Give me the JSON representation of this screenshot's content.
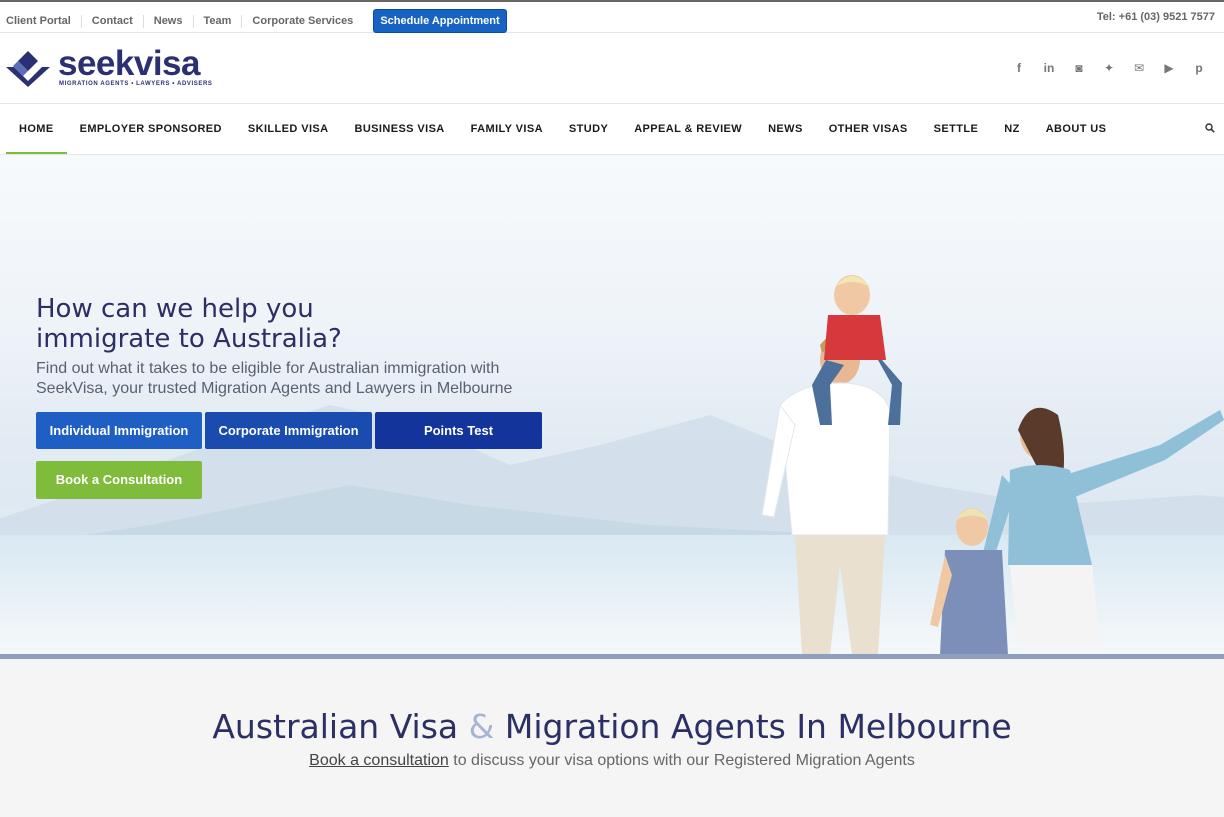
{
  "topbar": {
    "links": [
      "Client Portal",
      "Contact",
      "News",
      "Team",
      "Corporate Services"
    ],
    "schedule_label": "Schedule Appointment",
    "phone": "Tel: +61 (03) 9521 7577"
  },
  "brand": {
    "name": "seekvisa",
    "tagline": "MIGRATION AGENTS • LAWYERS • ADVISERS",
    "color": "#2b2f73"
  },
  "social": [
    {
      "icon": "facebook-icon",
      "glyph": "f"
    },
    {
      "icon": "linkedin-icon",
      "glyph": "in"
    },
    {
      "icon": "instagram-icon",
      "glyph": "◙"
    },
    {
      "icon": "twitter-icon",
      "glyph": "✦"
    },
    {
      "icon": "mail-icon",
      "glyph": "✉"
    },
    {
      "icon": "youtube-icon",
      "glyph": "▶"
    },
    {
      "icon": "pinterest-icon",
      "glyph": "p"
    }
  ],
  "nav": {
    "items": [
      "HOME",
      "EMPLOYER SPONSORED",
      "SKILLED VISA",
      "BUSINESS VISA",
      "FAMILY VISA",
      "STUDY",
      "APPEAL & REVIEW",
      "NEWS",
      "OTHER VISAS",
      "SETTLE",
      "NZ",
      "ABOUT US"
    ],
    "active": "HOME",
    "search_icon": "search-icon"
  },
  "hero": {
    "heading_line1": "How can we help you",
    "heading_line2": "immigrate to Australia?",
    "subtext_line1": "Find out what it takes to be eligible for Australian immigration with",
    "subtext_line2": "SeekVisa, your trusted Migration Agents and Lawyers in Melbourne",
    "buttons": {
      "individual": "Individual Immigration",
      "corporate": "Corporate Immigration",
      "points": "Points Test",
      "book": "Book a Consultation"
    }
  },
  "section": {
    "heading_part1": "Australian Visa",
    "heading_amp": "&",
    "heading_part2": "Migration Agents In Melbourne",
    "link_text": "Book a consultation",
    "rest_text": " to discuss your visa options with our Registered Migration Agents"
  },
  "colors": {
    "accent_green": "#7fbc3c",
    "accent_blue": "#1f5fc4",
    "navy": "#2b2f63"
  }
}
